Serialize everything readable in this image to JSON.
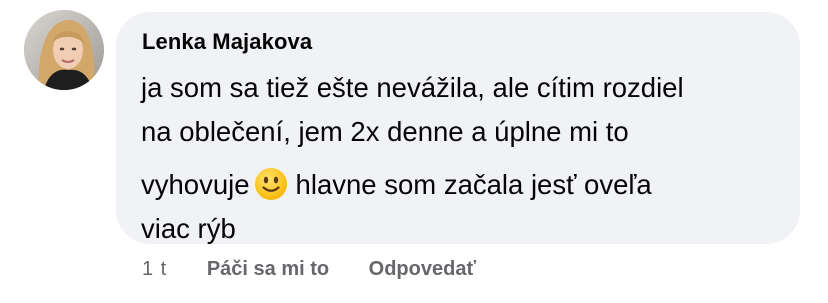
{
  "comment": {
    "author": "Lenka Majakova",
    "lines": [
      "ja som sa tiež ešte nevážila, ale cítim rozdiel",
      "na oblečení, jem 2x denne a úplne mi to"
    ],
    "line3_before": "vyhovuje",
    "line3_after": "hlavne som začala  jesť oveľa",
    "line4": "viac rýb",
    "emoji": "slightly-smiling-face-icon",
    "time": "1 t",
    "like_label": "Páči sa mi to",
    "reply_label": "Odpovedať"
  },
  "colors": {
    "bubble": "#f0f2f5",
    "text": "#050505",
    "meta": "#65676b",
    "emoji_face": "#fcc21b"
  }
}
